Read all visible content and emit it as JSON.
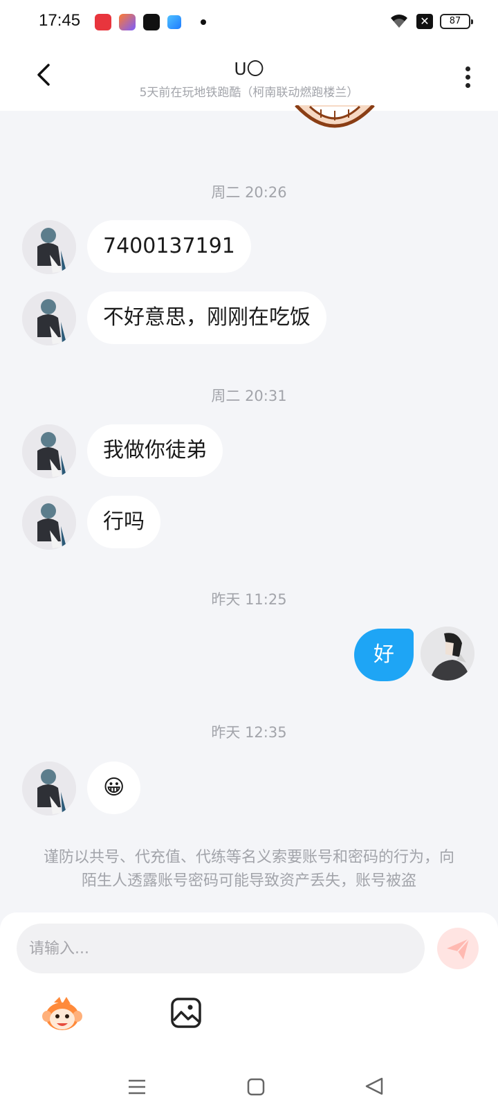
{
  "status_bar": {
    "time": "17:45",
    "battery": "87"
  },
  "header": {
    "title": "U〇",
    "subtitle": "5天前在玩地铁跑酷（柯南联动燃跑楼兰）"
  },
  "messages": [
    {
      "type": "timestamp",
      "text": "周二 20:26"
    },
    {
      "type": "incoming",
      "text": "7400137191"
    },
    {
      "type": "incoming",
      "text": "不好意思，刚刚在吃饭"
    },
    {
      "type": "timestamp",
      "text": "周二 20:31"
    },
    {
      "type": "incoming",
      "text": "我做你徒弟"
    },
    {
      "type": "incoming",
      "text": "行吗"
    },
    {
      "type": "timestamp",
      "text": "昨天 11:25"
    },
    {
      "type": "outgoing",
      "text": "好"
    },
    {
      "type": "timestamp",
      "text": "昨天 12:35"
    },
    {
      "type": "incoming",
      "text": "😀"
    }
  ],
  "notice": "谨防以共号、代充值、代练等名义索要账号和密码的行为，向陌生人透露账号密码可能导致资产丢失，账号被盗",
  "input": {
    "placeholder": "请输入..."
  },
  "icons": {
    "back": "back-arrow-icon",
    "more": "more-vertical-icon",
    "send": "send-icon",
    "emoji": "monkey-sticker-icon",
    "image": "image-icon",
    "nav_menu": "menu-icon",
    "nav_home": "home-square-icon",
    "nav_back": "back-triangle-icon"
  },
  "colors": {
    "background": "#f4f5f8",
    "outgoing_bubble": "#1ea5f5",
    "incoming_bubble": "#ffffff",
    "muted_text": "#a2a4aa",
    "send_button": "#ffe4e2"
  }
}
